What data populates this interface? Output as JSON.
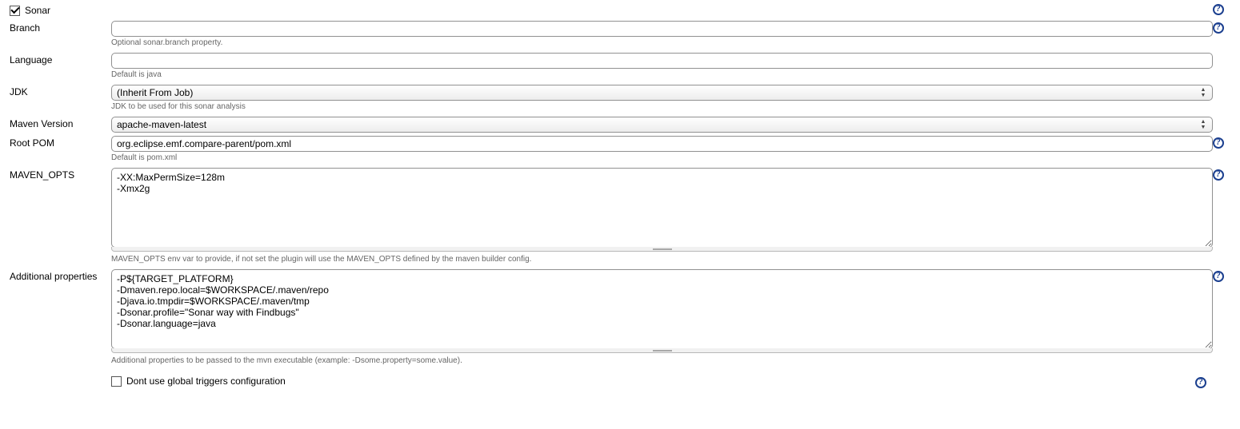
{
  "section": {
    "title": "Sonar",
    "checked": true
  },
  "fields": {
    "branch": {
      "label": "Branch",
      "value": "",
      "hint": "Optional sonar.branch property."
    },
    "language": {
      "label": "Language",
      "value": "",
      "hint": "Default is java"
    },
    "jdk": {
      "label": "JDK",
      "selected": "(Inherit From Job)",
      "hint": "JDK to be used for this sonar analysis"
    },
    "maven": {
      "label": "Maven Version",
      "selected": "apache-maven-latest"
    },
    "rootpom": {
      "label": "Root POM",
      "value": "org.eclipse.emf.compare-parent/pom.xml",
      "hint": "Default is pom.xml"
    },
    "mavenopts": {
      "label": "MAVEN_OPTS",
      "value": "-XX:MaxPermSize=128m\n-Xmx2g",
      "hint": "MAVEN_OPTS env var to provide, if not set the plugin will use the MAVEN_OPTS defined by the maven builder config."
    },
    "additional": {
      "label": "Additional properties",
      "value": "-P${TARGET_PLATFORM}\n-Dmaven.repo.local=$WORKSPACE/.maven/repo\n-Djava.io.tmpdir=$WORKSPACE/.maven/tmp\n-Dsonar.profile=\"Sonar way with Findbugs\"\n-Dsonar.language=java",
      "hint": "Additional properties to be passed to the mvn executable (example: -Dsome.property=some.value)."
    },
    "triggers": {
      "label": "Dont use global triggers configuration",
      "checked": false
    }
  }
}
